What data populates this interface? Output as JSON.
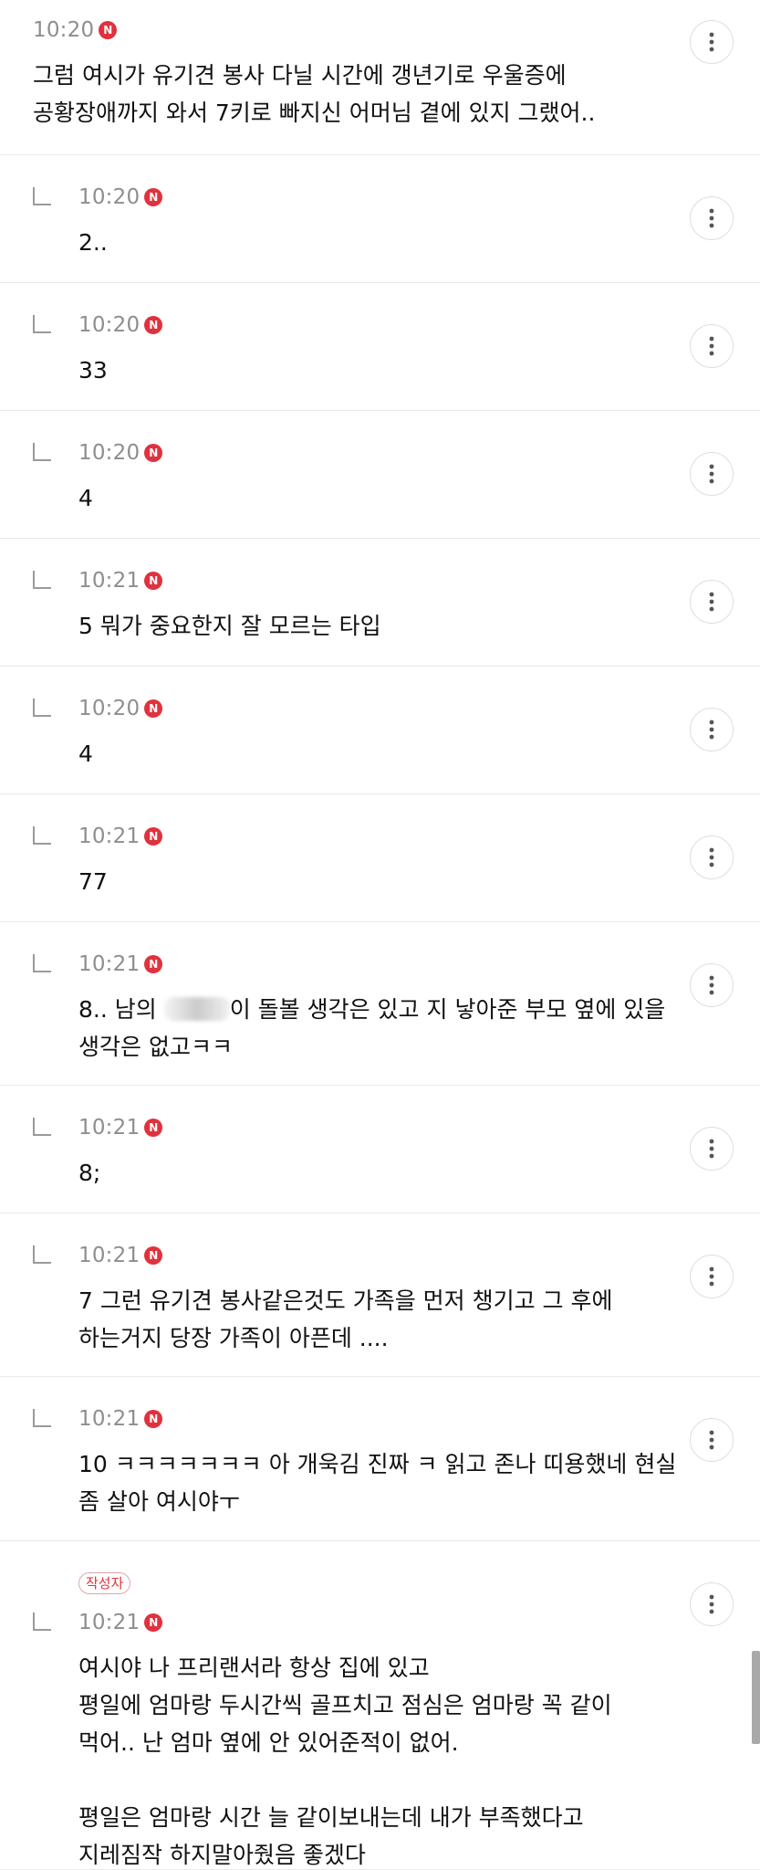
{
  "comments": [
    {
      "reply": false,
      "time": "10:20",
      "badge": "N",
      "text": "그럼 여시가 유기견 봉사 다닐 시간에 갱년기로 우울증에\n공황장애까지 와서 7키로 빠지신 어머님 곁에 있지 그랬어.."
    },
    {
      "reply": true,
      "time": "10:20",
      "badge": "N",
      "text": "2.."
    },
    {
      "reply": true,
      "time": "10:20",
      "badge": "N",
      "text": "33"
    },
    {
      "reply": true,
      "time": "10:20",
      "badge": "N",
      "text": "4"
    },
    {
      "reply": true,
      "time": "10:21",
      "badge": "N",
      "text": "5 뭐가 중요한지 잘 모르는 타입"
    },
    {
      "reply": true,
      "time": "10:20",
      "badge": "N",
      "text": "4"
    },
    {
      "reply": true,
      "time": "10:21",
      "badge": "N",
      "text": "77"
    },
    {
      "reply": true,
      "time": "10:21",
      "badge": "N",
      "text_before": "8.. 남의 ",
      "text_after": "이 돌볼 생각은 있고 지 낳아준 부모 옆에 있을\n생각은 없고ㅋㅋ"
    },
    {
      "reply": true,
      "time": "10:21",
      "badge": "N",
      "text": "8;"
    },
    {
      "reply": true,
      "time": "10:21",
      "badge": "N",
      "text": "7 그런 유기견 봉사같은것도 가족을 먼저 챙기고 그 후에\n하는거지 당장 가족이 아픈데 ...."
    },
    {
      "reply": true,
      "time": "10:21",
      "badge": "N",
      "text": "10 ㅋㅋㅋㅋㅋㅋㅋ 아 개욱김 진짜 ㅋ 읽고 존나 띠용했네 현실\n좀 살아 여시야ㅜ"
    },
    {
      "reply": true,
      "time": "10:21",
      "badge": "N",
      "author_label": "작성자",
      "text": "여시야 나 프리랜서라 항상 집에 있고\n평일에 엄마랑 두시간씩 골프치고 점심은 엄마랑 꼭 같이\n먹어.. 난 엄마 옆에 안 있어준적이 없어.\n\n평일은 엄마랑 시간 늘 같이보내는데 내가 부족했다고\n지레짐작 하지말아줬음 좋겠다"
    }
  ],
  "icons": {
    "more": "more-vertical-icon",
    "reply": "reply-arrow-icon",
    "new_badge": "new-badge-icon"
  },
  "colors": {
    "badge": "#e0323e",
    "time": "#8e8e8e",
    "divider": "#e9e9e9"
  }
}
